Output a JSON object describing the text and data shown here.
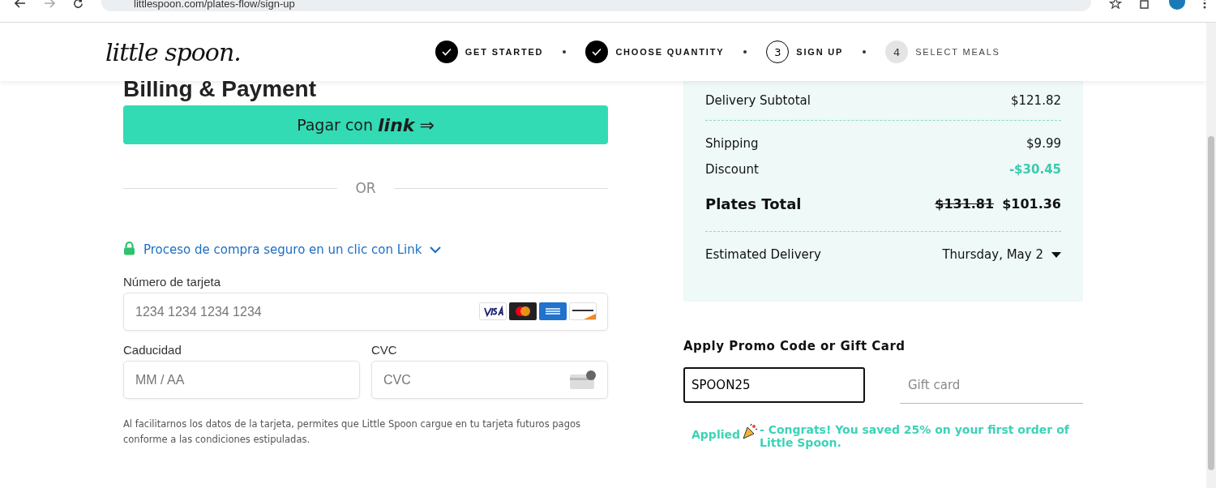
{
  "browser": {
    "address": "littlespoon.com/plates-flow/sign-up"
  },
  "header": {
    "logo": "little spoon.",
    "steps": [
      {
        "label": "GET STARTED",
        "completed": true
      },
      {
        "label": "CHOOSE QUANTITY",
        "completed": true
      },
      {
        "number": "3",
        "label": "SIGN UP",
        "completed": false,
        "current": true
      },
      {
        "number": "4",
        "label": "SELECT MEALS",
        "completed": false,
        "current": false
      }
    ]
  },
  "billing": {
    "title": "Billing & Payment",
    "pay_button": {
      "label": "Pagar con",
      "brand": "link",
      "arrow": "⇒"
    },
    "divider": "OR",
    "secure_link": "Proceso de compra seguro en un clic con Link",
    "card_number": {
      "label": "Número de tarjeta",
      "placeholder": "1234 1234 1234 1234"
    },
    "expiry": {
      "label": "Caducidad",
      "placeholder": "MM / AA"
    },
    "cvc": {
      "label": "CVC",
      "placeholder": "CVC"
    },
    "disclaimer": "Al facilitarnos los datos de la tarjeta, permites que Little Spoon cargue en tu tarjeta futuros pagos conforme a las condiciones estipuladas."
  },
  "summary": {
    "rows": [
      {
        "kind": "normal",
        "label": "Delivery Subtotal",
        "value": "$121.82"
      },
      {
        "kind": "divider"
      },
      {
        "kind": "normal",
        "label": "Shipping",
        "value": "$9.99"
      },
      {
        "kind": "discount",
        "label": "Discount",
        "value": "-$30.45"
      },
      {
        "kind": "total",
        "label": "Plates Total",
        "old_value": "$131.81",
        "value": "$101.36"
      },
      {
        "kind": "divider"
      },
      {
        "kind": "dropdown",
        "label": "Estimated Delivery",
        "value": "Thursday, May 2"
      }
    ]
  },
  "promo": {
    "title": "Apply Promo Code or Gift Card",
    "code": {
      "value": "SPOON25",
      "focused": true
    },
    "gift_card": {
      "placeholder": "Gift card"
    },
    "status": "Applied",
    "message": "- Congrats! You saved 25% on your first order of Little Spoon."
  }
}
